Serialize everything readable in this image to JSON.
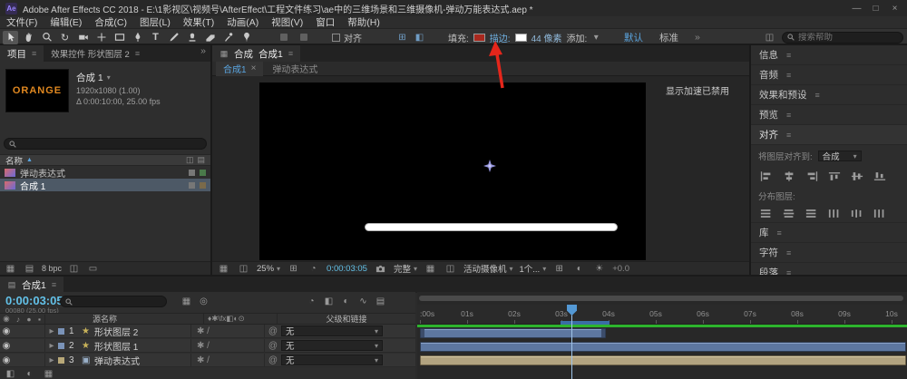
{
  "window": {
    "title": "Adobe After Effects CC 2018 - E:\\1影视区\\视频号\\AfterEffect\\工程文件练习\\ae中的三维场景和三维摄像机-弹动万能表达式.aep *",
    "app_badge": "Ae",
    "controls": {
      "minimize": "—",
      "maximize": "□",
      "close": "×"
    }
  },
  "menu": {
    "items": [
      "文件(F)",
      "编辑(E)",
      "合成(C)",
      "图层(L)",
      "效果(T)",
      "动画(A)",
      "视图(V)",
      "窗口",
      "帮助(H)"
    ]
  },
  "toolbar": {
    "snap_label": "对齐",
    "fill_label": "填充:",
    "stroke_label": "描边:",
    "stroke_width": "44 像素",
    "add_label": "添加:",
    "workspaces": [
      "默认",
      "标准"
    ],
    "overflow": "»",
    "search_placeholder": "搜索帮助",
    "fill_color": "#a8281e",
    "stroke_color": "#ffffff"
  },
  "project": {
    "tab": "项目",
    "effects_tab": "效果控件 形状图层 2",
    "thumb_text": "ORANGE",
    "comp_name": "合成 1",
    "meta_line1": "1920x1080 (1.00)",
    "meta_line2": "Δ 0:00:10:00, 25.00 fps",
    "name_header": "名称",
    "items": [
      {
        "name": "弹动表达式"
      },
      {
        "name": "合成 1"
      }
    ],
    "bpc": "8 bpc"
  },
  "comp": {
    "panel_title": "合成",
    "active_comp": "合成1",
    "viewer_tabs": [
      "合成1",
      "弹动表达式"
    ],
    "overlay_notice": "显示加速已禁用",
    "zoom": "25%",
    "time": "0:00:03:05",
    "resolution": "完整",
    "camera": "活动摄像机",
    "views": "1个...",
    "exposure": "+0.0"
  },
  "right_panel": {
    "sections": [
      "信息",
      "音频",
      "效果和预设",
      "预览",
      "对齐",
      "库",
      "字符",
      "段落"
    ],
    "align": {
      "target_label": "将图层对齐到:",
      "target_value": "合成",
      "distribute_label": "分布图层:"
    }
  },
  "timeline": {
    "tab": "合成1",
    "time": "0:00:03:05",
    "time_sub": "00080 (25.00 fps)",
    "col_source": "源名称",
    "col_parent": "父级和链接",
    "switch_header": "♦✱\\fx◧◐⊙",
    "row_switches": "✱ /",
    "layers": [
      {
        "num": "1",
        "name": "形状图层 2",
        "parent": "无"
      },
      {
        "num": "2",
        "name": "形状图层 1",
        "parent": "无"
      },
      {
        "num": "3",
        "name": "弹动表达式",
        "parent": "无"
      }
    ],
    "ruler": [
      ":00s",
      "01s",
      "02s",
      "03s",
      "04s",
      "05s",
      "06s",
      "07s",
      "08s",
      "09s",
      "10s"
    ]
  },
  "icons": {
    "menu": "≡",
    "overflow": "»",
    "dropdown": "▾",
    "expand": "▸",
    "sort": "▲",
    "close": "×",
    "rotate_tool": "↻",
    "text_tool": "T",
    "eye": "◉",
    "audio": "♪",
    "solo": "●",
    "lock": "▪",
    "star_layer": "★",
    "comp_layer": "▣",
    "pickwhip": "@",
    "grid": "▦",
    "guides": "◫",
    "mask_region": "⊞",
    "snapshot": "◎",
    "exposure_sun": "☀",
    "wave": "∿",
    "motion_blur": "◐",
    "frame_blend": "◧",
    "shy": "◔",
    "film": "▤",
    "trash": "▭"
  },
  "colors": {
    "accent_blue": "#5aa5e0",
    "time_cyan": "#63c1e8",
    "render_green": "#2db42d",
    "layer_blue": "#5d77a0",
    "layer_tan": "#b2a380",
    "arrow_red": "#e5261b",
    "star_purple": "#9595dd"
  }
}
